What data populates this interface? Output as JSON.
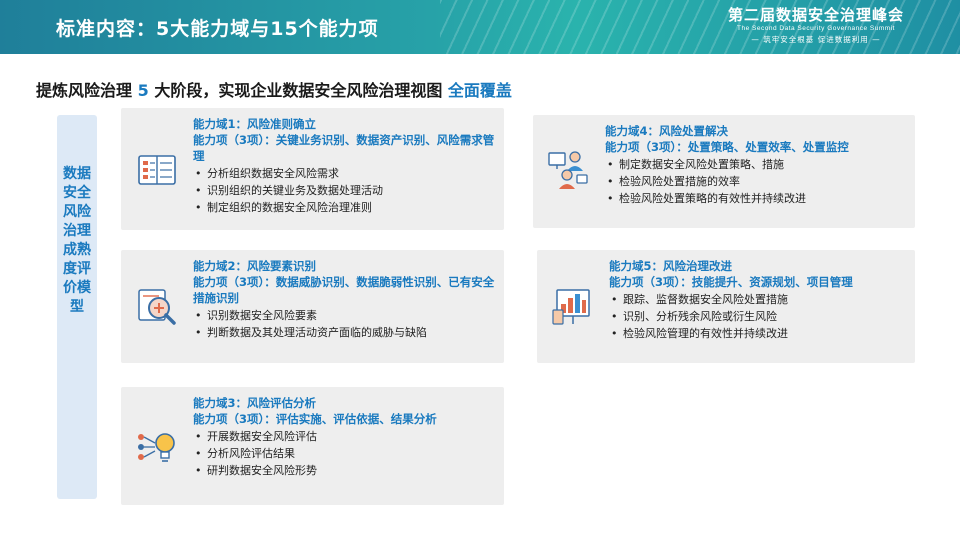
{
  "header": {
    "title": "标准内容：5大能力域与15个能力项",
    "brand_name": "第二届数据安全治理峰会",
    "brand_en": "The Second Data Security Governance Summit",
    "brand_slogan": "— 筑牢安全根基  促进数据利用 —"
  },
  "subtitle": {
    "part1": "提炼风险治理",
    "number": "5",
    "part2": "大阶段，实现企业数据安全风险治理视图",
    "highlight": "全面覆盖"
  },
  "side_label": "数据安全风险治理成熟度评价模型",
  "domains": [
    {
      "title": "能力域1：风险准则确立",
      "items": "能力项（3项）：关键业务识别、数据资产识别、风险需求管理",
      "bullets": [
        "分析组织数据安全风险需求",
        "识别组织的关键业务及数据处理活动",
        "制定组织的数据安全风险治理准则"
      ],
      "icon": "document-list-icon"
    },
    {
      "title": "能力域2：风险要素识别",
      "items": "能力项（3项）：数据威胁识别、数据脆弱性识别、已有安全措施识别",
      "bullets": [
        "识别数据安全风险要素",
        "判断数据及其处理活动资产面临的威胁与缺陷"
      ],
      "icon": "magnifier-icon"
    },
    {
      "title": "能力域3：风险评估分析",
      "items": "能力项（3项）：评估实施、评估依据、结果分析",
      "bullets": [
        "开展数据安全风险评估",
        "分析风险评估结果",
        "研判数据安全风险形势"
      ],
      "icon": "lightbulb-icon"
    },
    {
      "title": "能力域4：风险处置解决",
      "items": "能力项（3项）：处置策略、处置效率、处置监控",
      "bullets": [
        "制定数据安全风险处置策略、措施",
        "检验风险处置措施的效率",
        "检验风险处置策略的有效性并持续改进"
      ],
      "icon": "people-monitor-icon"
    },
    {
      "title": "能力域5：风险治理改进",
      "items": "能力项（3项）：技能提升、资源规划、项目管理",
      "bullets": [
        "跟踪、监督数据安全风险处置措施",
        "识别、分析残余风险或衍生风险",
        "检验风险管理的有效性并持续改进"
      ],
      "icon": "chart-board-icon"
    }
  ],
  "colors": {
    "accent": "#1a7abf",
    "header_start": "#1f7f9a",
    "header_mid": "#2ab3ad",
    "card_bg": "#eeeeee",
    "side_bg": "#dde9f6"
  }
}
